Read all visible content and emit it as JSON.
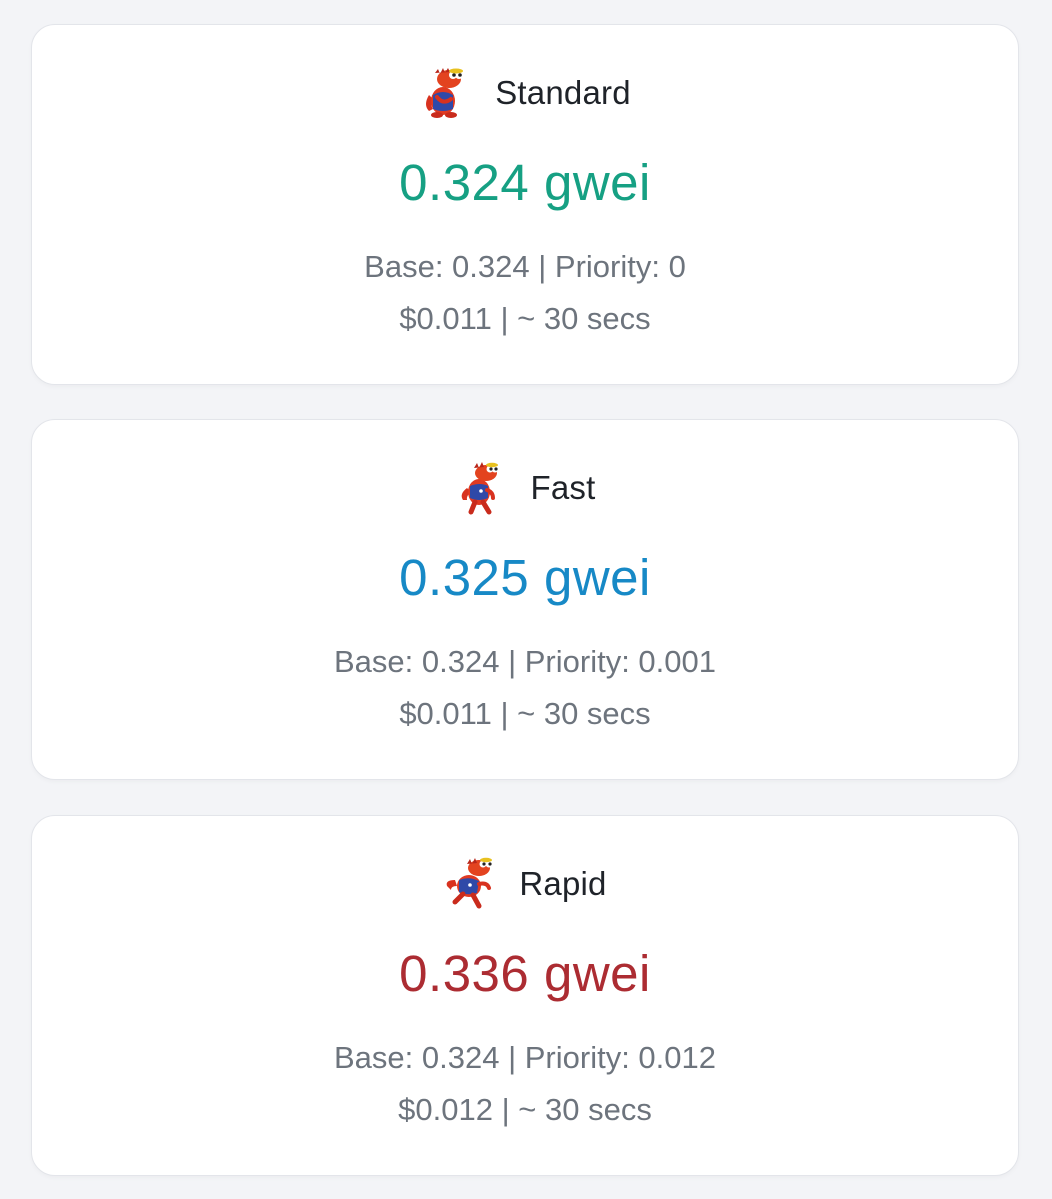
{
  "tiers": [
    {
      "label": "Standard",
      "icon": "dinosaur-sitting-icon",
      "price": "0.324 gwei",
      "base_priority": "Base: 0.324 | Priority: 0",
      "cost_time": "$0.011 | ~ 30 secs",
      "color": "#16a083"
    },
    {
      "label": "Fast",
      "icon": "dinosaur-walking-icon",
      "price": "0.325 gwei",
      "base_priority": "Base: 0.324 | Priority: 0.001",
      "cost_time": "$0.011 | ~ 30 secs",
      "color": "#1789c6"
    },
    {
      "label": "Rapid",
      "icon": "dinosaur-running-icon",
      "price": "0.336 gwei",
      "base_priority": "Base: 0.324 | Priority: 0.012",
      "cost_time": "$0.012 | ~ 30 secs",
      "color": "#ac2c32"
    }
  ]
}
